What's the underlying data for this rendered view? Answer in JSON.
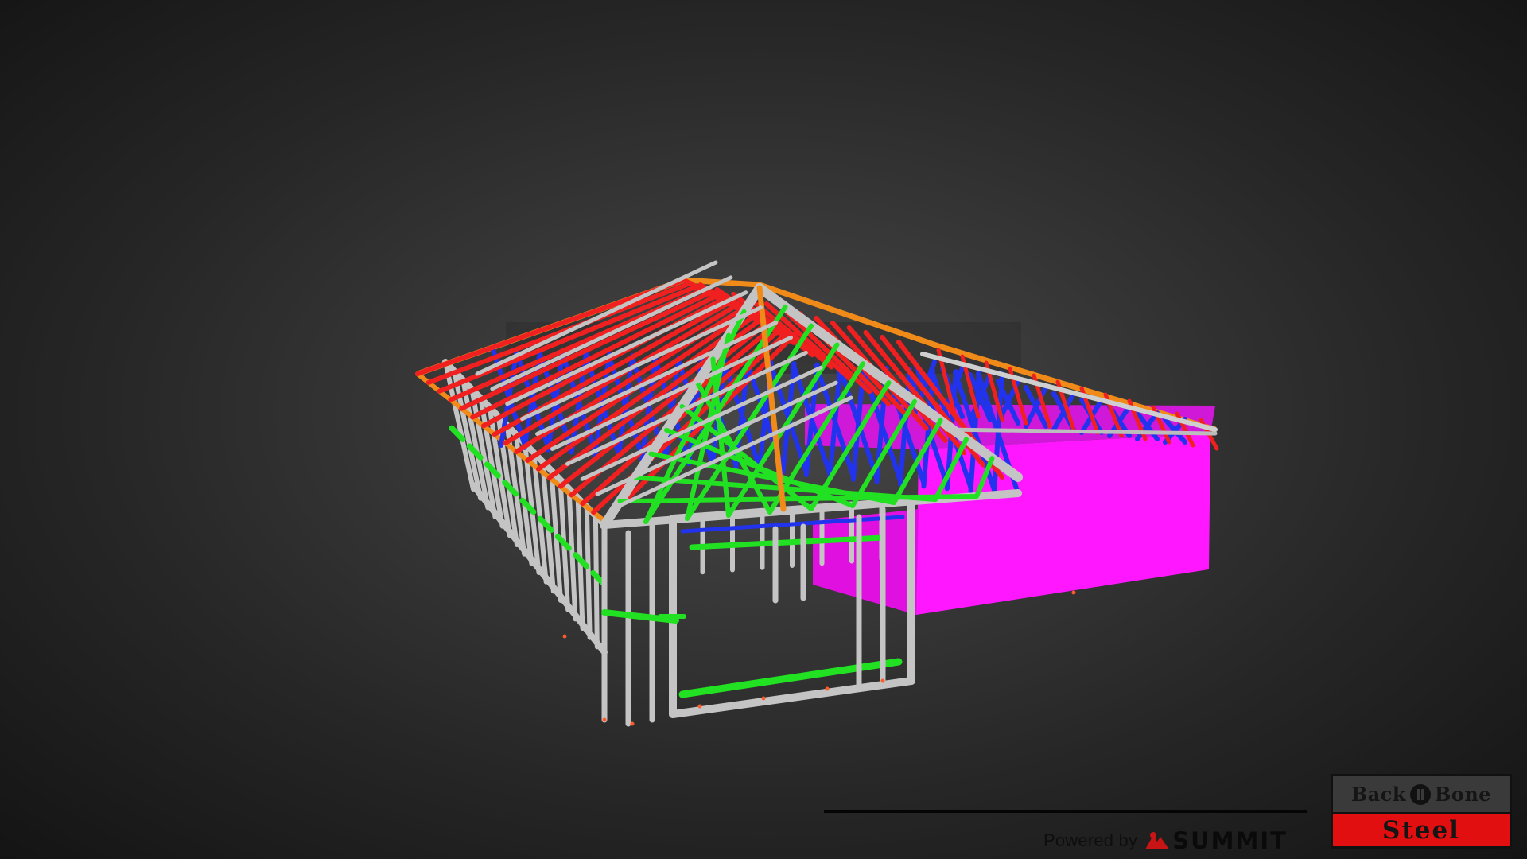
{
  "viewer": {
    "model": "steel frame house 3d model",
    "background_colors": [
      "#474747",
      "#141414"
    ]
  },
  "colors": {
    "top_chord": "#f02020",
    "web_member": "#2233ee",
    "fascia": "#f08a18",
    "nogging": "#22e022",
    "wall_frame": "#c4c4c4",
    "cladding": "#ff18ff"
  },
  "branding": {
    "powered_by": "Powered by",
    "summit_icon": "summit-logo-icon",
    "summit_name": "SUMMIT"
  },
  "logo": {
    "top_left": "Back",
    "top_right": "Bone",
    "bottom": "Steel",
    "accent": "#e10f0f"
  }
}
